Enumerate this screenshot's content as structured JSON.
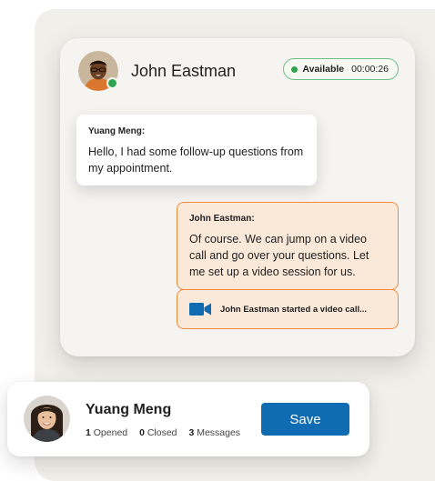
{
  "chat": {
    "agent": {
      "name": "John Eastman",
      "online": true
    },
    "status": {
      "label": "Available",
      "timer": "00:00:26",
      "color": "#2ea44f"
    },
    "messages": [
      {
        "sender": "Yuang Meng:",
        "text": "Hello, I had some follow-up questions from my appointment."
      },
      {
        "sender": "John Eastman:",
        "text": "Of course. We can jump on a video call and go over your questions. Let me set up a video session for us."
      }
    ],
    "system_event": {
      "icon": "video-camera-icon",
      "text": "John Eastman started a video call..."
    }
  },
  "profile": {
    "name": "Yuang Meng",
    "stats": [
      {
        "count": "1",
        "label": "Opened"
      },
      {
        "count": "0",
        "label": "Closed"
      },
      {
        "count": "3",
        "label": "Messages"
      }
    ],
    "save_label": "Save"
  },
  "colors": {
    "accent": "#0f6cb2",
    "agent_bubble_border": "#ef8a3a",
    "agent_bubble_bg": "#fae9d9",
    "status_green": "#2ea44f"
  }
}
